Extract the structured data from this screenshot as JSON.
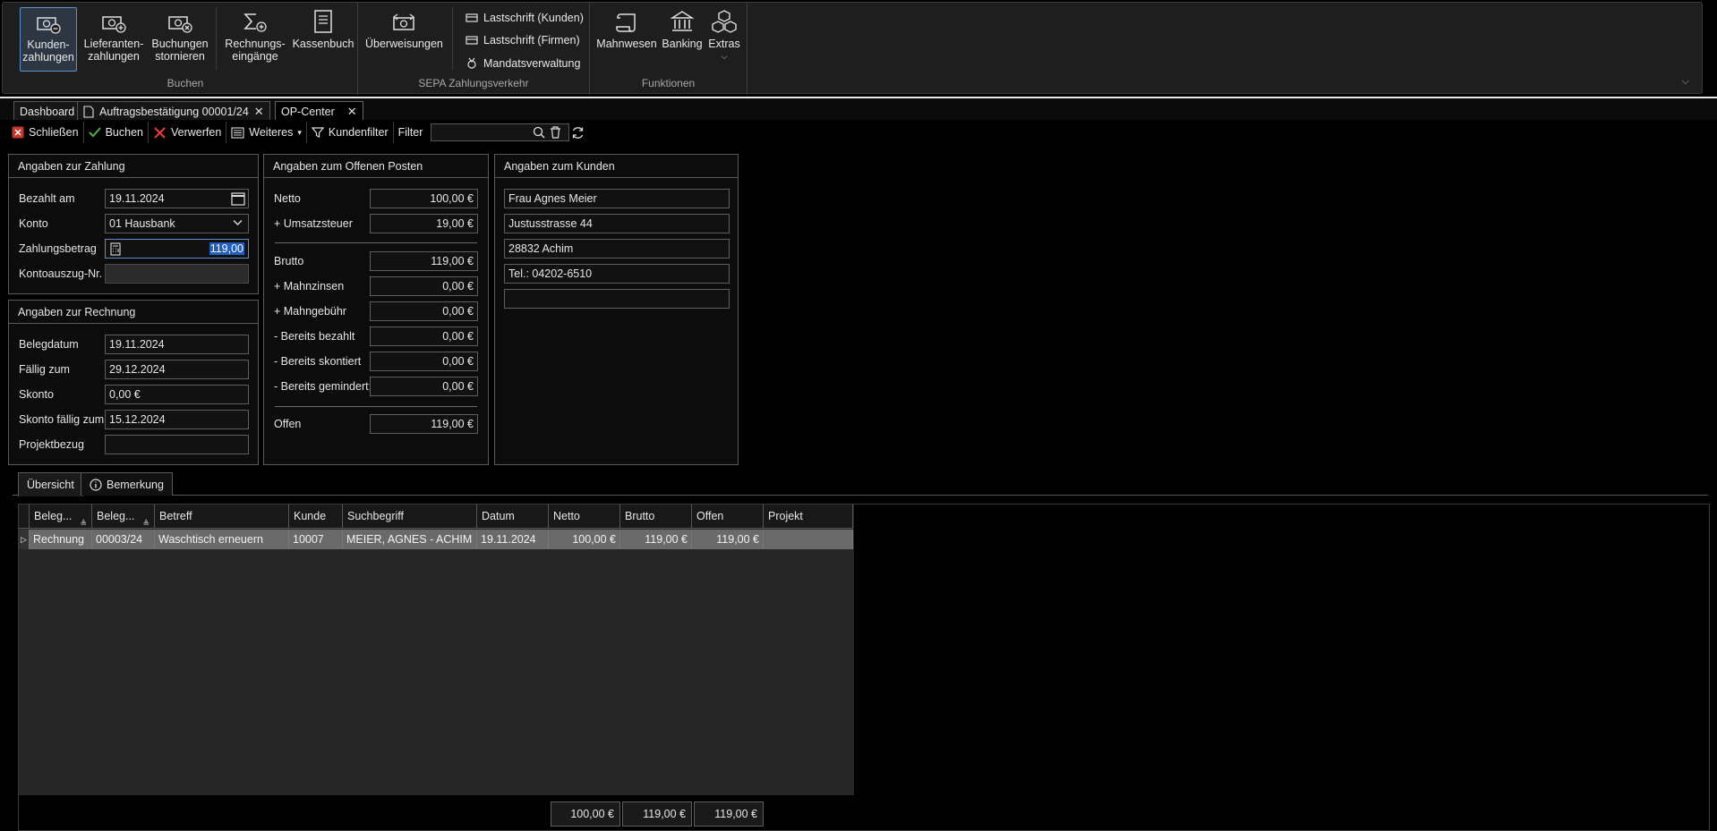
{
  "ribbon": {
    "buchen": {
      "label": "Buchen",
      "kunden_line1": "Kunden-",
      "kunden_line2": "zahlungen",
      "lieferanten_line1": "Lieferanten-",
      "lieferanten_line2": "zahlungen",
      "stornieren_line1": "Buchungen",
      "stornieren_line2": "stornieren",
      "rechnungs_line1": "Rechnungs-",
      "rechnungs_line2": "eingänge",
      "kassenbuch": "Kassenbuch"
    },
    "sepa": {
      "label": "SEPA Zahlungsverkehr",
      "ueberweisungen": "Überweisungen",
      "lastschrift_kunden": "Lastschrift (Kunden)",
      "lastschrift_firmen": "Lastschrift (Firmen)",
      "mandatsverwaltung": "Mandatsverwaltung"
    },
    "funktionen": {
      "label": "Funktionen",
      "mahnwesen": "Mahnwesen",
      "banking": "Banking",
      "extras": "Extras"
    }
  },
  "tabs": [
    {
      "label": "Dashboard"
    },
    {
      "label": "Auftragsbestätigung 00001/24"
    },
    {
      "label": "OP-Center"
    }
  ],
  "toolbar": {
    "schliessen": "Schließen",
    "buchen": "Buchen",
    "verwerfen": "Verwerfen",
    "weiteres": "Weiteres",
    "kundenfilter": "Kundenfilter",
    "filter": "Filter",
    "filter_value": ""
  },
  "zahlung": {
    "title": "Angaben zur Zahlung",
    "bezahlt_am_label": "Bezahlt am",
    "bezahlt_am": "19.11.2024",
    "konto_label": "Konto",
    "konto": "01 Hausbank",
    "betrag_label": "Zahlungsbetrag",
    "betrag": "119,00",
    "kontoauszug_label": "Kontoauszug-Nr.",
    "kontoauszug": ""
  },
  "rechnung": {
    "title": "Angaben zur Rechnung",
    "belegdatum_label": "Belegdatum",
    "belegdatum": "19.11.2024",
    "faellig_label": "Fällig zum",
    "faellig": "29.12.2024",
    "skonto_label": "Skonto",
    "skonto": "0,00 €",
    "skonto_faellig_label": "Skonto fällig zum",
    "skonto_faellig": "15.12.2024",
    "projektbezug_label": "Projektbezug",
    "projektbezug": ""
  },
  "posten": {
    "title": "Angaben zum Offenen Posten",
    "netto_label": "Netto",
    "netto": "100,00 €",
    "ust_label": "+ Umsatzsteuer",
    "ust": "19,00 €",
    "brutto_label": "Brutto",
    "brutto": "119,00 €",
    "mahnzinsen_label": "+ Mahnzinsen",
    "mahnzinsen": "0,00 €",
    "mahngebuehr_label": "+ Mahngebühr",
    "mahngebuehr": "0,00 €",
    "bezahlt_label": "- Bereits bezahlt",
    "bezahlt": "0,00 €",
    "skontiert_label": "- Bereits skontiert",
    "skontiert": "0,00 €",
    "gemindert_label": "- Bereits gemindert:",
    "gemindert": "0,00 €",
    "offen_label": "Offen",
    "offen": "119,00 €"
  },
  "kunde": {
    "title": "Angaben zum Kunden",
    "name": "Frau Agnes Meier",
    "strasse": "Justusstrasse 44",
    "ort": "28832 Achim",
    "tel": "Tel.: 04202-6510",
    "extra": ""
  },
  "bottom_tabs": {
    "uebersicht": "Übersicht",
    "bemerkung": "Bemerkung"
  },
  "table": {
    "columns": [
      "Beleg...",
      "Beleg...",
      "Betreff",
      "Kunde",
      "Suchbegriff",
      "Datum",
      "Netto",
      "Brutto",
      "Offen",
      "Projekt"
    ],
    "rows": [
      [
        "Rechnung",
        "00003/24",
        "Waschtisch erneuern",
        "10007",
        "MEIER, AGNES - ACHIM",
        "19.11.2024",
        "100,00 €",
        "119,00 €",
        "119,00 €",
        ""
      ]
    ],
    "totals": {
      "netto": "100,00 €",
      "brutto": "119,00 €",
      "offen": "119,00 €"
    }
  },
  "colors": {
    "accent": "#5d8fc9",
    "close_red": "#c0392b",
    "check_green": "#4caf50",
    "selection": "#1e5fbf"
  }
}
